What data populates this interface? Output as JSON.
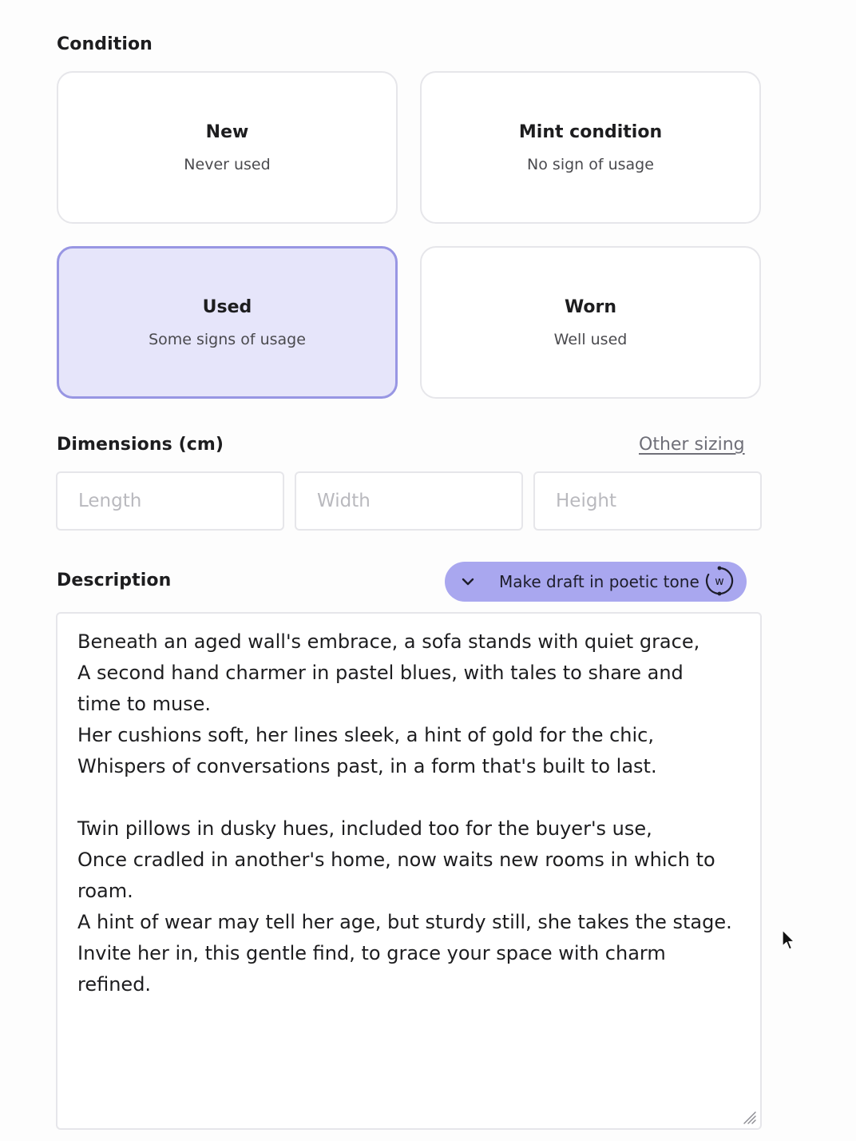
{
  "condition": {
    "label": "Condition",
    "options": [
      {
        "title": "New",
        "subtitle": "Never used",
        "selected": false
      },
      {
        "title": "Mint condition",
        "subtitle": "No sign of usage",
        "selected": false
      },
      {
        "title": "Used",
        "subtitle": "Some signs of usage",
        "selected": true
      },
      {
        "title": "Worn",
        "subtitle": "Well used",
        "selected": false
      }
    ]
  },
  "dimensions": {
    "label": "Dimensions (cm)",
    "other_sizing_link": "Other sizing",
    "length": {
      "value": "",
      "placeholder": "Length"
    },
    "width": {
      "value": "",
      "placeholder": "Width"
    },
    "height": {
      "value": "",
      "placeholder": "Height"
    }
  },
  "description": {
    "label": "Description",
    "ai_button": {
      "label": "Make draft in poetic tone",
      "chevron_icon": "chevron-down-icon",
      "logo_icon": "w-logo-icon"
    },
    "lines": [
      "Beneath an aged wall's embrace, a sofa stands with quiet grace,",
      "A second hand charmer in pastel blues, with tales to share and",
      "time to muse.",
      "Her cushions soft, her lines sleek, a hint of gold for the chic,",
      "Whispers of conversations past, in a form that's built to last.",
      "",
      "Twin pillows in dusky hues, included too for the buyer's use,",
      "Once cradled in another's home, now waits new rooms in which to",
      "roam.",
      "A hint of wear may tell her age, but sturdy still, she takes the stage.",
      "Invite her in, this gentle find, to grace your space with charm",
      "refined."
    ]
  },
  "colors": {
    "selected_card_bg": "#e6e5fa",
    "selected_card_border": "#9896e3",
    "ai_button_bg": "#a9a7ef",
    "card_border": "#e6e6ea"
  }
}
